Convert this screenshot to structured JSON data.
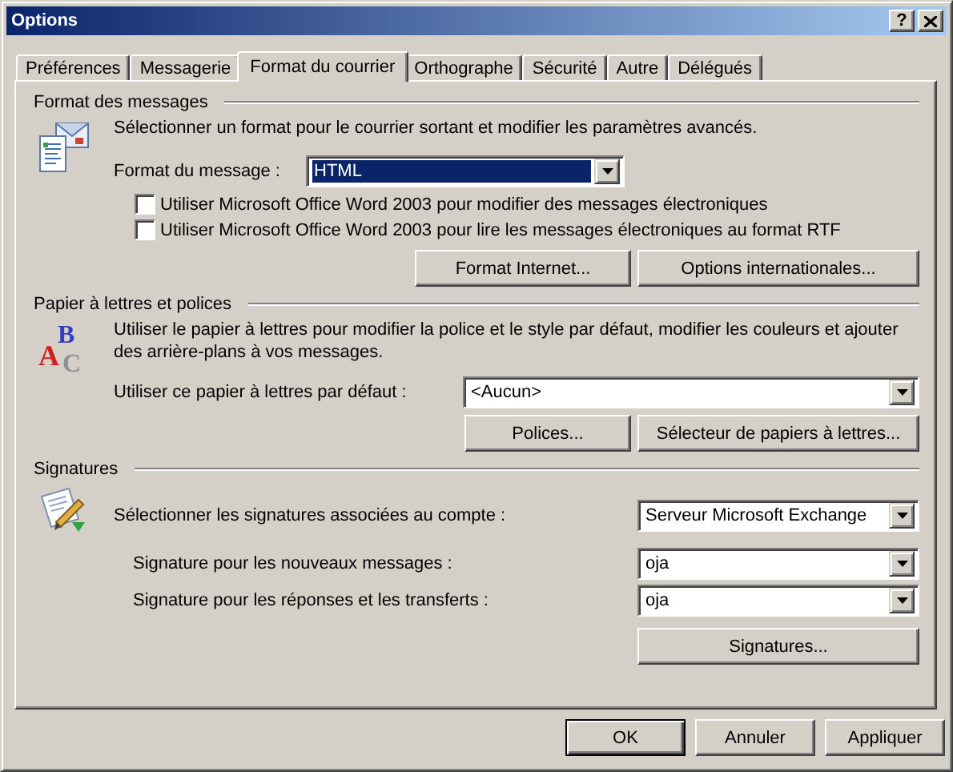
{
  "window": {
    "title": "Options",
    "help": "?"
  },
  "tabs": [
    {
      "label": "Préférences",
      "selected": false
    },
    {
      "label": "Messagerie",
      "selected": false
    },
    {
      "label": "Format du courrier",
      "selected": true
    },
    {
      "label": "Orthographe",
      "selected": false
    },
    {
      "label": "Sécurité",
      "selected": false
    },
    {
      "label": "Autre",
      "selected": false
    },
    {
      "label": "Délégués",
      "selected": false
    }
  ],
  "message_format": {
    "title": "Format des messages",
    "description": "Sélectionner un format pour le courrier sortant et modifier les paramètres avancés.",
    "format_label": "Format du message :",
    "format_value": "HTML",
    "format_highlighted": true,
    "checkboxes": [
      {
        "label": "Utiliser Microsoft Office Word 2003 pour modifier des messages électroniques",
        "checked": false
      },
      {
        "label": "Utiliser Microsoft Office Word 2003 pour lire les messages électroniques au format RTF",
        "checked": false
      }
    ],
    "buttons": [
      "Format Internet...",
      "Options internationales..."
    ]
  },
  "stationery": {
    "title": "Papier à lettres et polices",
    "icon_letters": [
      "A",
      "B",
      "C"
    ],
    "description": "Utiliser le papier à lettres pour modifier la police et le style par défaut, modifier les couleurs et ajouter des arrière-plans à vos messages.",
    "default_label": "Utiliser ce papier à lettres par défaut :",
    "default_value": "<Aucun>",
    "buttons": [
      "Polices...",
      "Sélecteur de papiers à lettres..."
    ]
  },
  "signatures": {
    "title": "Signatures",
    "account_label": "Sélectionner les signatures associées au compte :",
    "account_value": "Serveur Microsoft Exchange",
    "fields": [
      {
        "label": "Signature pour les nouveaux messages :",
        "value": "oja"
      },
      {
        "label": "Signature pour les réponses et les transferts :",
        "value": "oja"
      }
    ],
    "button": "Signatures..."
  },
  "dialog_buttons": [
    {
      "label": "OK",
      "default": true
    },
    {
      "label": "Annuler",
      "default": false
    },
    {
      "label": "Appliquer",
      "default": false
    }
  ]
}
